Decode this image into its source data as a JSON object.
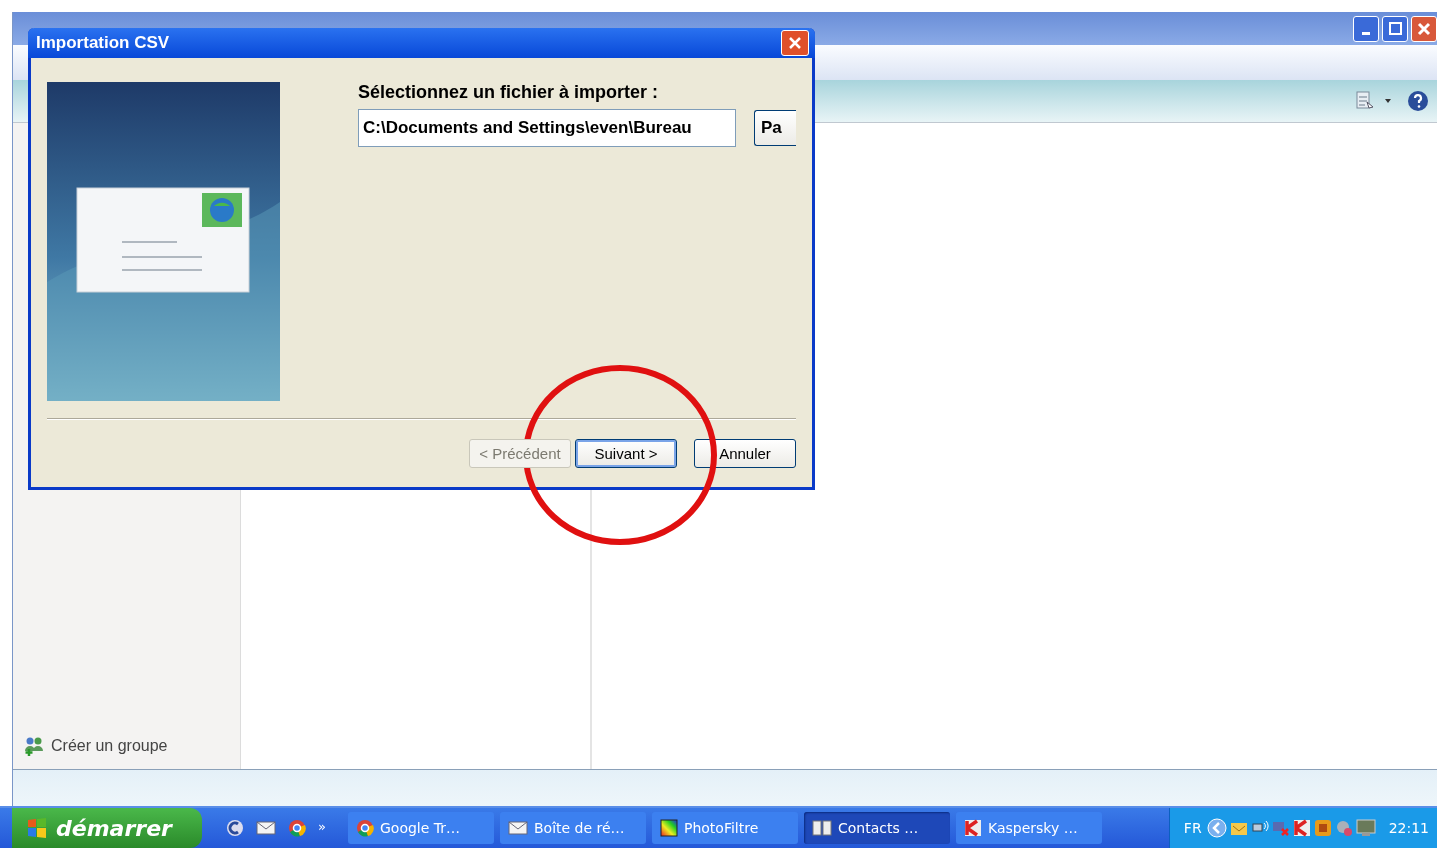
{
  "sidebar": {
    "create_group": "Créer un groupe"
  },
  "dialog": {
    "title": "Importation CSV",
    "prompt": "Sélectionnez un fichier à importer :",
    "file_path": "C:\\Documents and Settings\\even\\Bureau",
    "browse_button": "Pa",
    "buttons": [
      {
        "label": "< Précédent",
        "disabled": true,
        "default": false
      },
      {
        "label": "Suivant >",
        "disabled": false,
        "default": true
      },
      {
        "label": "Annuler",
        "disabled": false,
        "default": false
      }
    ]
  },
  "taskbar": {
    "start": "démarrer",
    "more": "»",
    "tasks": [
      {
        "label": "Google Tr…",
        "selected": false
      },
      {
        "label": "Boîte de ré…",
        "selected": false
      },
      {
        "label": "PhotoFiltre",
        "selected": false
      },
      {
        "label": "Contacts …",
        "selected": true
      },
      {
        "label": "Kaspersky …",
        "selected": false
      }
    ],
    "language": "FR",
    "clock": "22:11"
  }
}
